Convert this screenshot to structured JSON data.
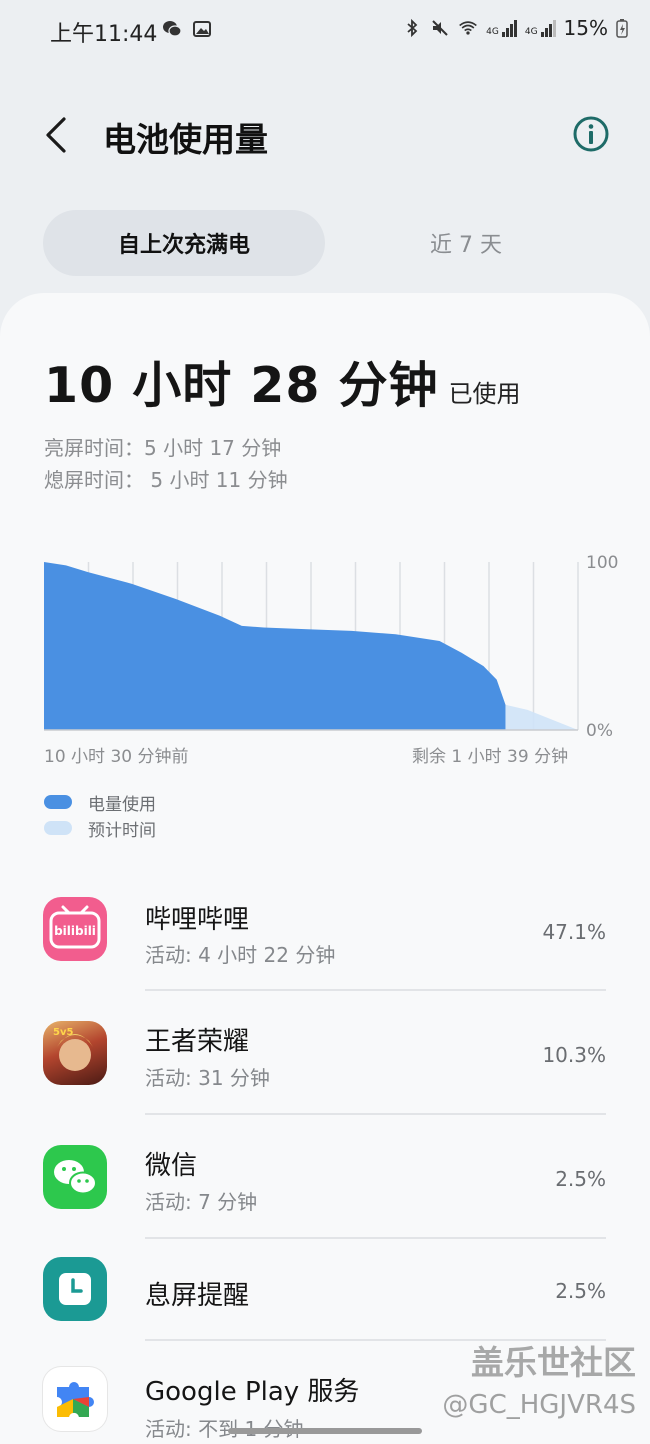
{
  "status_bar": {
    "time": "上午11:44",
    "battery_percent": "15%",
    "network_labels": [
      "4G",
      "4G"
    ]
  },
  "header": {
    "title": "电池使用量",
    "back_icon": "chevron-left-icon",
    "info_icon": "info-icon"
  },
  "tabs": [
    {
      "label": "自上次充满电",
      "active": true
    },
    {
      "label": "近 7 天",
      "active": false
    }
  ],
  "summary": {
    "total": "10 小时 28 分钟",
    "total_suffix": "已使用",
    "screen_on": "亮屏时间：5 小时 17 分钟",
    "screen_off": "熄屏时间：  5 小时 11 分钟"
  },
  "chart_data": {
    "type": "area",
    "title": "",
    "y_ticks": [
      "100",
      "0%"
    ],
    "ylim": [
      0,
      100
    ],
    "x_start_label": "10 小时 30 分钟前",
    "x_end_label": "剩余 1 小时 39 分钟",
    "x_unit": "hours since full charge",
    "xlim": [
      0,
      12.15
    ],
    "grid_vertical": true,
    "series": [
      {
        "name": "电量使用",
        "color": "#4a90e2",
        "x": [
          0,
          0.5,
          1.0,
          2.0,
          3.0,
          4.0,
          4.5,
          5.0,
          6.0,
          7.0,
          8.0,
          8.5,
          9.0,
          9.5,
          10.0,
          10.3,
          10.5
        ],
        "y": [
          100,
          98,
          94,
          87,
          78,
          68,
          62,
          61,
          60,
          59,
          57,
          55,
          53,
          46,
          38,
          30,
          15
        ]
      },
      {
        "name": "预计时间",
        "color": "#cfe3f7",
        "x": [
          10.5,
          11.0,
          12.15
        ],
        "y": [
          15,
          12,
          0
        ]
      }
    ]
  },
  "legend": [
    {
      "label": "电量使用",
      "color": "#4a90e2"
    },
    {
      "label": "预计时间",
      "color": "#cfe3f7"
    }
  ],
  "apps": [
    {
      "name": "哔哩哔哩",
      "sub": "活动: 4 小时 22 分钟",
      "percent": "47.1%",
      "icon": "bilibili-app-icon",
      "icon_text": "bilibili",
      "color": "#f25d8e"
    },
    {
      "name": "王者荣耀",
      "sub": "活动: 31 分钟",
      "percent": "10.3%",
      "icon": "honor-of-kings-app-icon",
      "icon_text": "5v5",
      "color": "#7a2b1e"
    },
    {
      "name": "微信",
      "sub": "活动: 7 分钟",
      "percent": "2.5%",
      "icon": "wechat-app-icon",
      "color": "#2dc84d"
    },
    {
      "name": "息屏提醒",
      "sub": "",
      "percent": "2.5%",
      "icon": "clock-app-icon",
      "color": "#1b9a94"
    },
    {
      "name": "Google Play 服务",
      "sub": "活动: 不到 1 分钟",
      "percent": "",
      "icon": "google-play-services-icon",
      "color": "#ffffff"
    }
  ],
  "watermark": {
    "line1": "盖乐世社区",
    "line2": "@GC_HGJVR4S"
  }
}
